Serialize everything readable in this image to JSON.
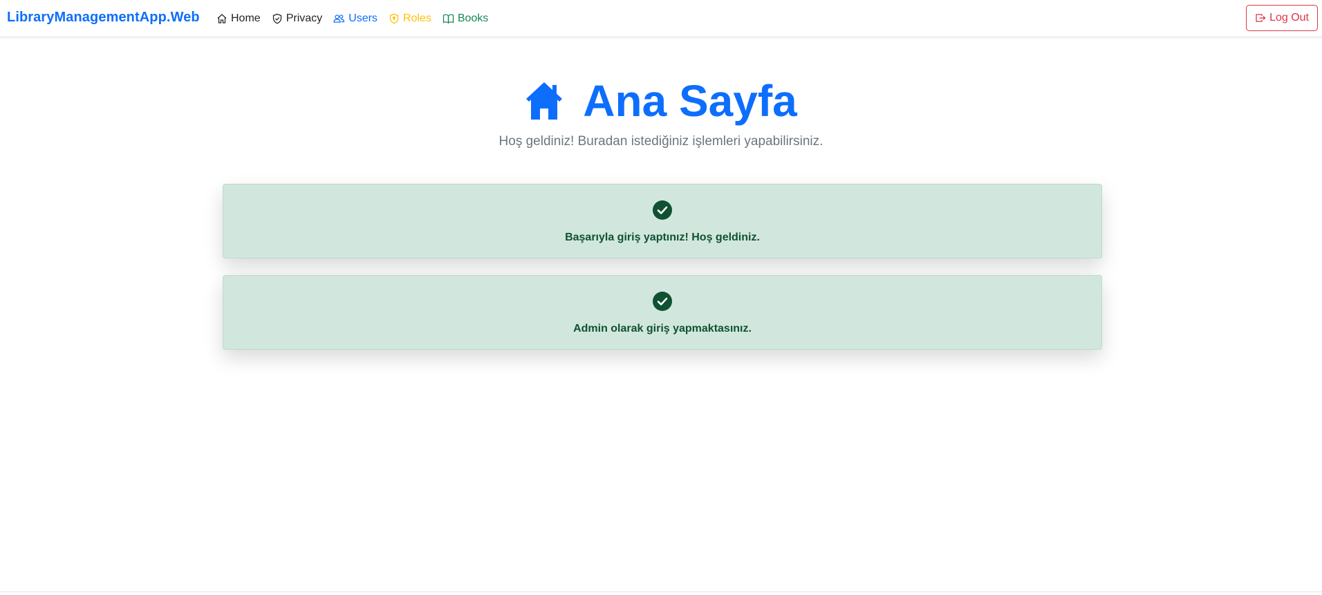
{
  "navbar": {
    "brand": "LibraryManagementApp.Web",
    "links": [
      {
        "label": "Home",
        "icon": "house-icon",
        "color": "#212529"
      },
      {
        "label": "Privacy",
        "icon": "shield-icon",
        "color": "#212529"
      },
      {
        "label": "Users",
        "icon": "people-icon",
        "color": "#0d6efd"
      },
      {
        "label": "Roles",
        "icon": "shield-lock-icon",
        "color": "#ffc107"
      },
      {
        "label": "Books",
        "icon": "book-icon",
        "color": "#198754"
      }
    ],
    "logout_label": "Log Out",
    "logout_icon": "box-arrow-right-icon",
    "logout_color": "#dc3545"
  },
  "hero": {
    "title": "Ana Sayfa",
    "title_icon": "house-fill-icon",
    "subtitle": "Hoş geldiniz! Buradan istediğiniz işlemleri yapabilirsiniz."
  },
  "alerts": [
    {
      "text": "Başarıyla giriş yaptınız! Hoş geldiniz.",
      "icon": "check-circle-fill-icon"
    },
    {
      "text": "Admin olarak giriş yapmaktasınız.",
      "icon": "check-circle-fill-icon"
    }
  ],
  "colors": {
    "primary": "#0d6efd",
    "success_bg": "#d1e7dd",
    "success_text": "#0f5132",
    "danger": "#dc3545",
    "warning": "#ffc107",
    "success": "#198754"
  }
}
